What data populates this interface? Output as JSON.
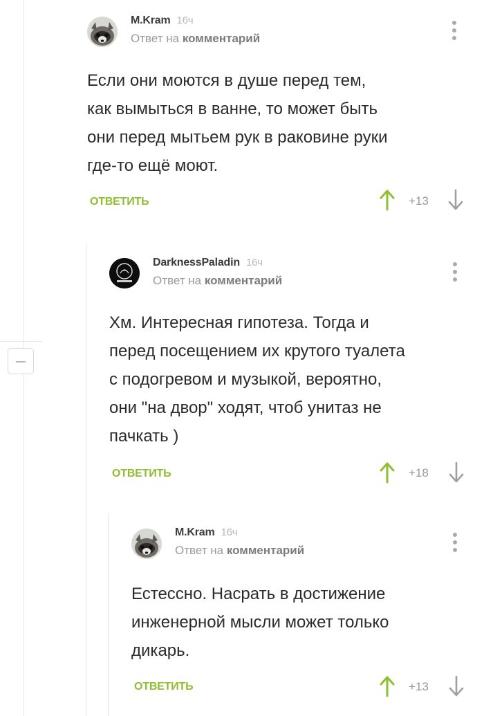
{
  "comments": [
    {
      "author": "M.Kram",
      "time": "16ч",
      "reply_prefix": "Ответ на",
      "reply_target": "комментарий",
      "text": "Если они моются в душе перед тем,\nкак вымыться в ванне, то может быть\nони перед мытьем рук в раковине руки\nгде-то ещё моют.",
      "reply_label": "ОТВЕТИТЬ",
      "rating": "+13"
    },
    {
      "author": "DarknessPaladin",
      "time": "16ч",
      "reply_prefix": "Ответ на",
      "reply_target": "комментарий",
      "text": "Хм. Интересная гипотеза. Тогда и\nперед посещением их крутого туалета\nс подогревом и музыкой, вероятно,\nони \"на двор\" ходят, чтоб унитаз не\nпачкать )",
      "reply_label": "ОТВЕТИТЬ",
      "rating": "+18"
    },
    {
      "author": "M.Kram",
      "time": "16ч",
      "reply_prefix": "Ответ на",
      "reply_target": "комментарий",
      "text": "Естессно. Насрать в достижение\nинженерной мысли может только\nдикарь.",
      "reply_label": "ОТВЕТИТЬ",
      "rating": "+13"
    }
  ],
  "colors": {
    "accent_green": "#8dbf2f",
    "muted_text": "#9a9a9a",
    "thread_line": "#e6e6e6"
  },
  "icons": {
    "upvote": "arrow-up-icon",
    "downvote": "arrow-down-icon",
    "menu": "more-vertical-icon",
    "collapse": "minus-icon"
  }
}
